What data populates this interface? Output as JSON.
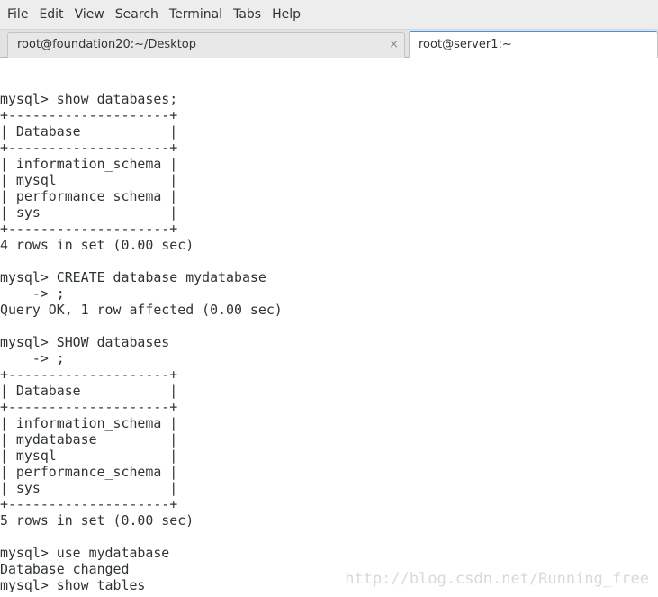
{
  "menubar": {
    "items": [
      "File",
      "Edit",
      "View",
      "Search",
      "Terminal",
      "Tabs",
      "Help"
    ]
  },
  "tabs": [
    {
      "title": "root@foundation20:~/Desktop",
      "active": false,
      "close_glyph": "×"
    },
    {
      "title": "root@server1:~",
      "active": true
    }
  ],
  "terminal": {
    "lines": [
      "mysql> show databases;",
      "+--------------------+",
      "| Database           |",
      "+--------------------+",
      "| information_schema |",
      "| mysql              |",
      "| performance_schema |",
      "| sys                |",
      "+--------------------+",
      "4 rows in set (0.00 sec)",
      "",
      "mysql> CREATE database mydatabase",
      "    -> ;",
      "Query OK, 1 row affected (0.00 sec)",
      "",
      "mysql> SHOW databases",
      "    -> ;",
      "+--------------------+",
      "| Database           |",
      "+--------------------+",
      "| information_schema |",
      "| mydatabase         |",
      "| mysql              |",
      "| performance_schema |",
      "| sys                |",
      "+--------------------+",
      "5 rows in set (0.00 sec)",
      "",
      "mysql> use mydatabase",
      "Database changed",
      "mysql> show tables"
    ]
  },
  "watermark": "http://blog.csdn.net/Running_free",
  "colors": {
    "accent": "#4a90d9",
    "text": "#2e3436",
    "menubar_bg": "#ededed"
  }
}
